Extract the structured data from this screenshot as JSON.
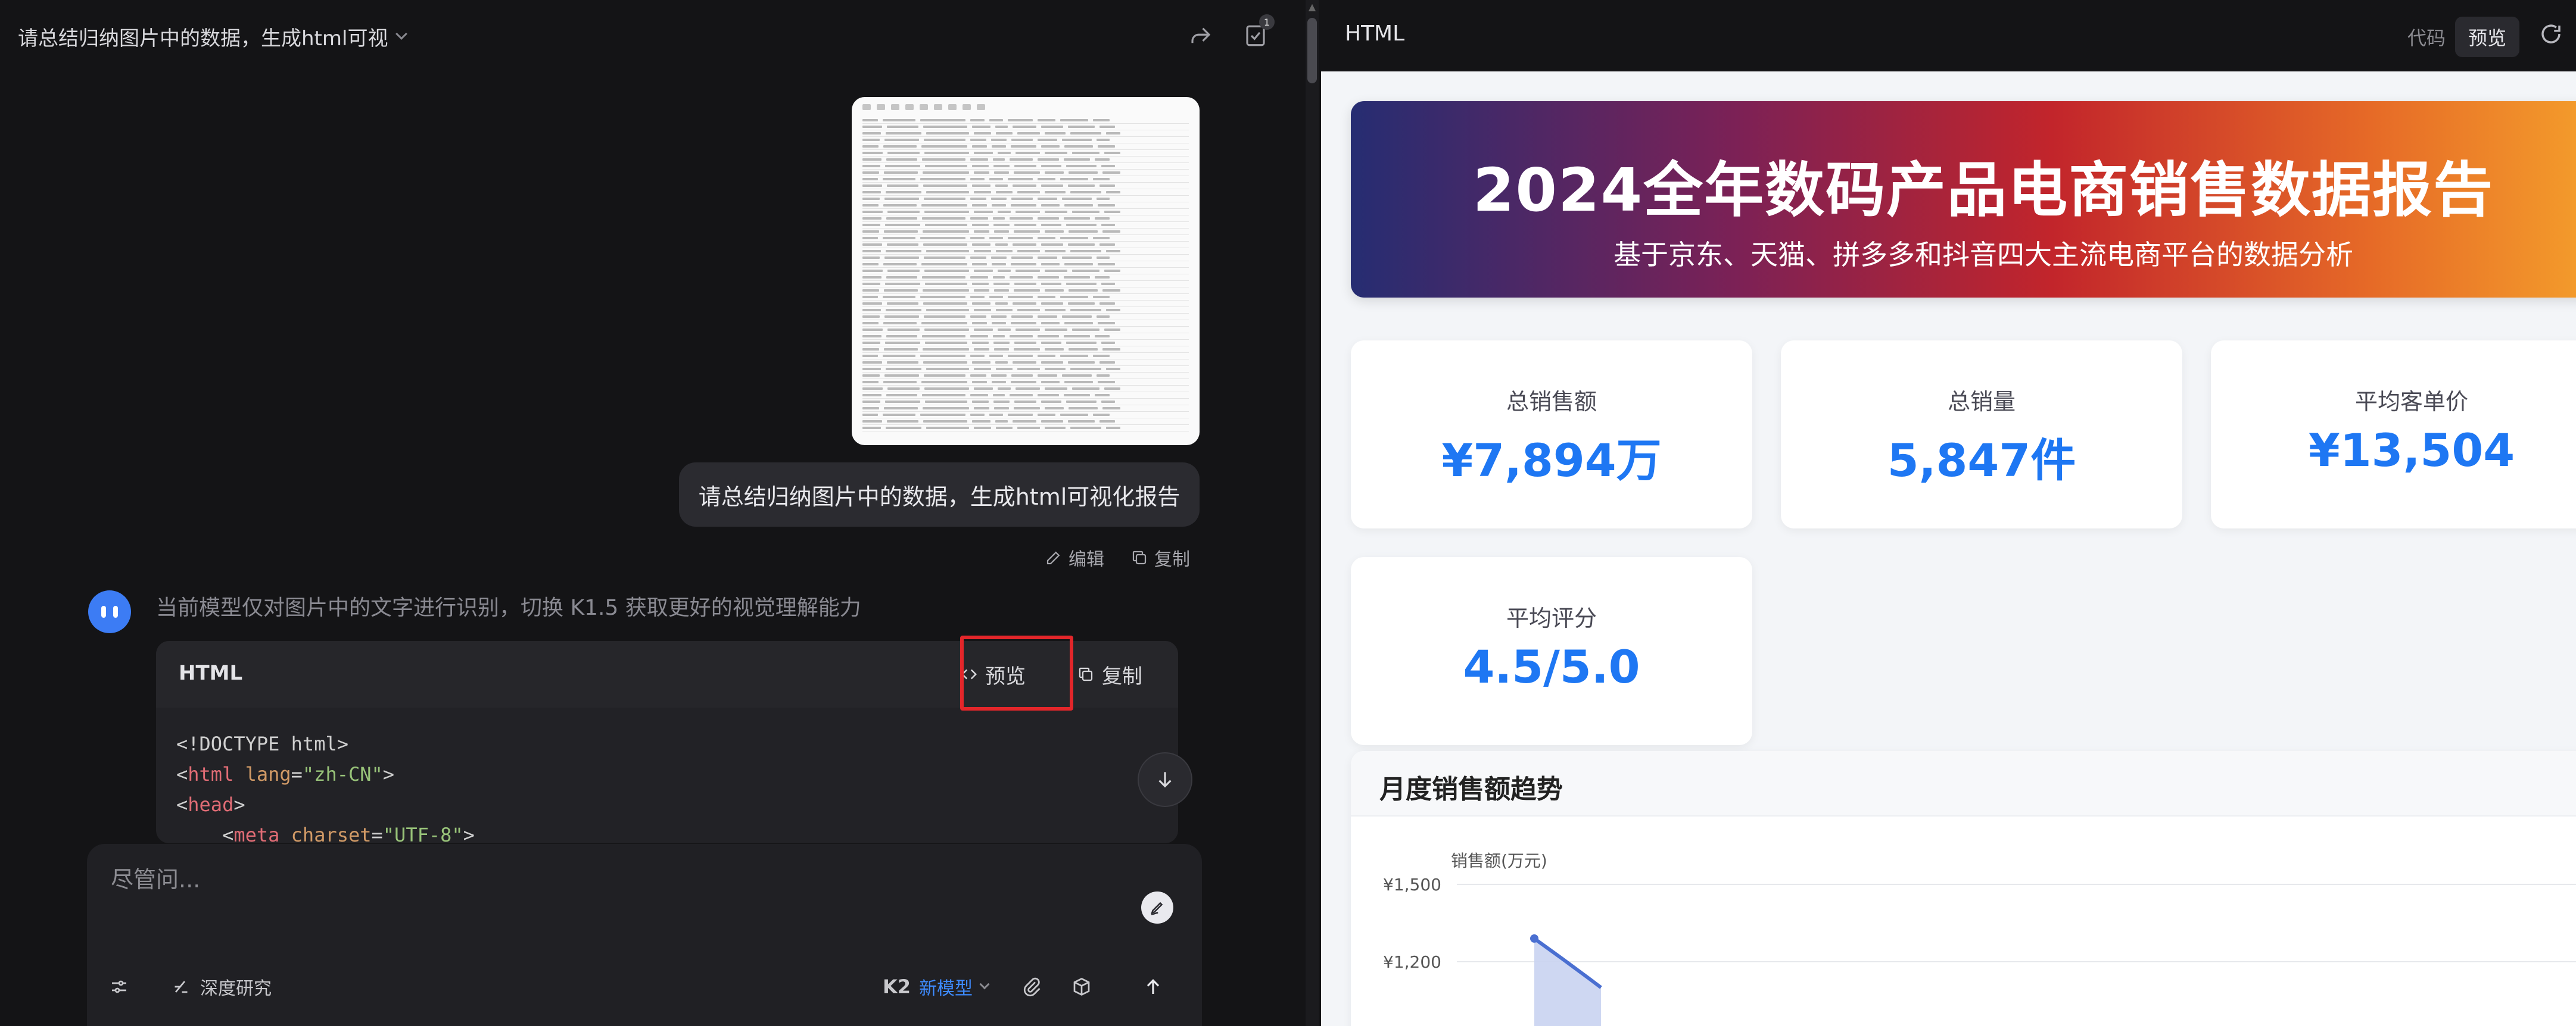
{
  "chat": {
    "title": "请总结归纳图片中的数据，生成html可视",
    "user_message": "请总结归纳图片中的数据，生成html可视化报告",
    "edit_label": "编辑",
    "copy_label": "复制",
    "model_notice": "当前模型仅对图片中的文字进行识别，切换 K1.5 获取更好的视觉理解能力",
    "header_badge": "1",
    "code_block": {
      "language": "HTML",
      "preview_label": "预览",
      "copy_label": "复制",
      "line1": "<!DOCTYPE html>",
      "line2_open": "<",
      "line2_tag": "html",
      "line2_attr": "lang",
      "line2_eq": "=",
      "line2_val": "\"zh-CN\"",
      "line2_close": ">",
      "line3_open": "<",
      "line3_tag": "head",
      "line3_close": ">",
      "line4_open": "<",
      "line4_tag": "meta",
      "line4_attr": "charset",
      "line4_eq": "=",
      "line4_val": "\"UTF-8\"",
      "line4_close": ">"
    },
    "composer": {
      "placeholder": "尽管问...",
      "deep_research_label": "深度研究",
      "model_name": "K2",
      "model_tag": "新模型"
    }
  },
  "preview": {
    "panel_title": "HTML",
    "tab_code": "代码",
    "tab_preview": "预览",
    "banner_title": "2024全年数码产品电商销售数据报告",
    "banner_subtitle": "基于京东、天猫、拼多多和抖音四大主流电商平台的数据分析",
    "kpis": [
      {
        "label": "总销售额",
        "value": "¥7,894万"
      },
      {
        "label": "总销量",
        "value": "5,847件"
      },
      {
        "label": "平均客单价",
        "value": "¥13,504"
      },
      {
        "label": "平均评分",
        "value": "4.5/5.0"
      }
    ],
    "colors": {
      "accent": "#1e77f3",
      "line": "#4a6fd1",
      "area": "#c9d3f1"
    }
  },
  "chart_data": {
    "type": "line",
    "title": "月度销售额趋势",
    "ylabel": "销售额(万元)",
    "y_ticks": [
      "¥1,500",
      "¥1,200"
    ],
    "series": [
      {
        "values": [
          1290,
          1100
        ]
      }
    ]
  }
}
